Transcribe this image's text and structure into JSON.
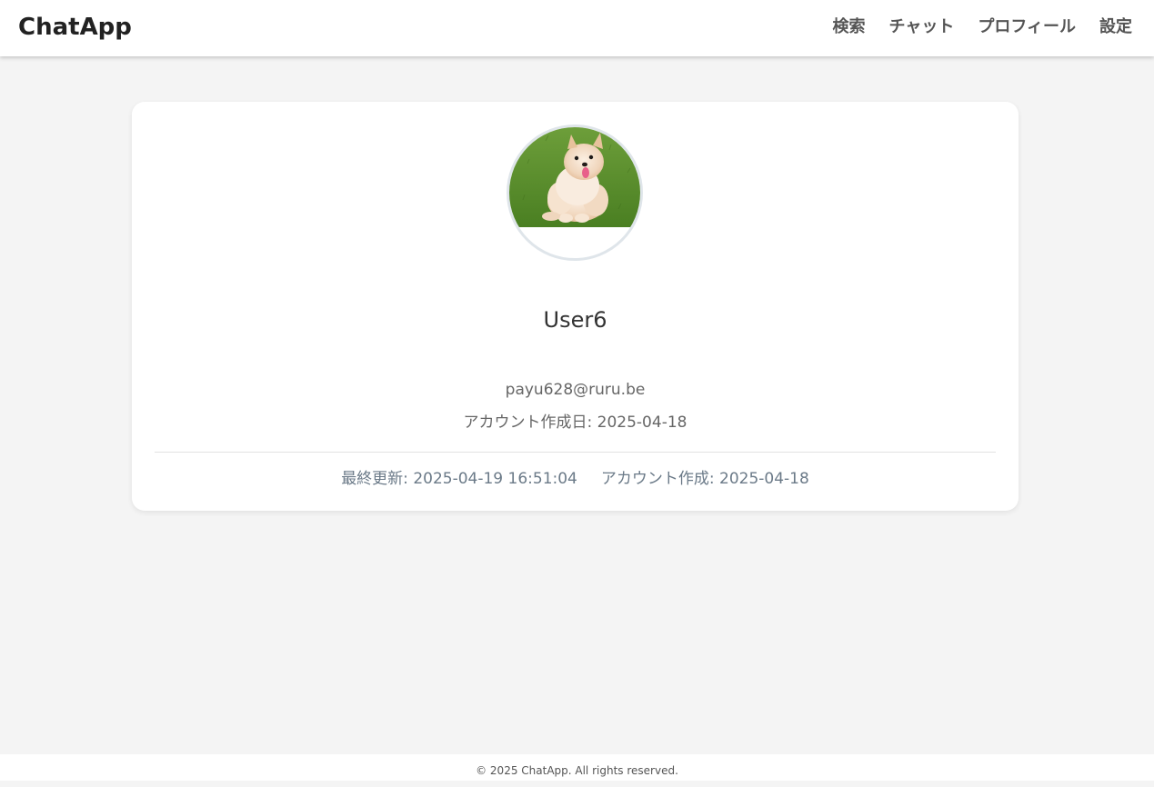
{
  "app": {
    "brand": "ChatApp"
  },
  "nav": {
    "items": [
      {
        "label": "検索"
      },
      {
        "label": "チャット"
      },
      {
        "label": "プロフィール"
      },
      {
        "label": "設定"
      }
    ]
  },
  "profile": {
    "avatar_alt": "dog-photo",
    "username": "User6",
    "email": "payu628@ruru.be",
    "created_line": "アカウント作成日: 2025-04-18",
    "last_updated": "最終更新: 2025-04-19 16:51:04",
    "account_created": "アカウント作成: 2025-04-18"
  },
  "footer": {
    "text": "© 2025 ChatApp. All rights reserved."
  },
  "colors": {
    "background": "#f4f4f4",
    "card": "#ffffff",
    "avatar_border": "#dfe5ea",
    "meta_text": "#6b7a88"
  }
}
